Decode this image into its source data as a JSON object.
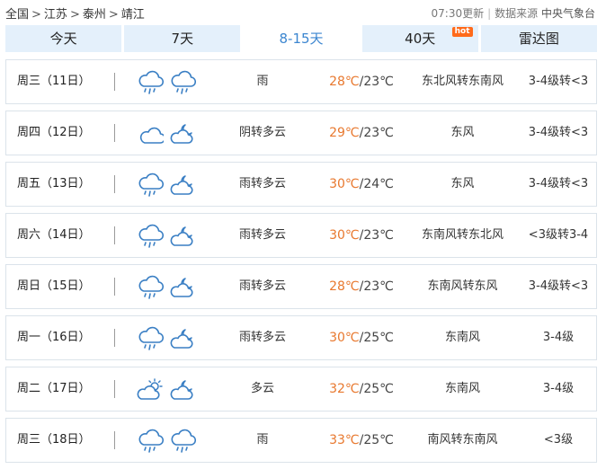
{
  "breadcrumb": [
    "全国",
    "江苏",
    "泰州",
    "靖江"
  ],
  "meta": {
    "updated": "07:30更新",
    "source_label": "数据来源",
    "source": "中央气象台"
  },
  "tabs": [
    {
      "label": "今天",
      "active": false,
      "hot": ""
    },
    {
      "label": "7天",
      "active": false,
      "hot": ""
    },
    {
      "label": "8-15天",
      "active": true,
      "hot": ""
    },
    {
      "label": "40天",
      "active": false,
      "hot": "hot"
    },
    {
      "label": "雷达图",
      "active": false,
      "hot": ""
    }
  ],
  "colors": {
    "high_temp": "#e8782e",
    "tab_bg": "#e4f0fb",
    "tab_active": "#3c86d0",
    "icon": "#3a7fc4"
  },
  "days": [
    {
      "day": "周三（11日）",
      "icons": [
        "rain-icon",
        "rain-icon"
      ],
      "desc": "雨",
      "high": "28℃",
      "low": "/23℃",
      "wind_dir": "东北风转东南风",
      "wind_level": "3-4级转<3"
    },
    {
      "day": "周四（12日）",
      "icons": [
        "cloudy-icon",
        "partly-cloudy-night-icon"
      ],
      "desc": "阴转多云",
      "high": "29℃",
      "low": "/23℃",
      "wind_dir": "东风",
      "wind_level": "3-4级转<3"
    },
    {
      "day": "周五（13日）",
      "icons": [
        "rain-icon",
        "partly-cloudy-night-icon"
      ],
      "desc": "雨转多云",
      "high": "30℃",
      "low": "/24℃",
      "wind_dir": "东风",
      "wind_level": "3-4级转<3"
    },
    {
      "day": "周六（14日）",
      "icons": [
        "rain-icon",
        "partly-cloudy-night-icon"
      ],
      "desc": "雨转多云",
      "high": "30℃",
      "low": "/23℃",
      "wind_dir": "东南风转东北风",
      "wind_level": "<3级转3-4"
    },
    {
      "day": "周日（15日）",
      "icons": [
        "rain-icon",
        "partly-cloudy-night-icon"
      ],
      "desc": "雨转多云",
      "high": "28℃",
      "low": "/23℃",
      "wind_dir": "东南风转东风",
      "wind_level": "3-4级转<3"
    },
    {
      "day": "周一（16日）",
      "icons": [
        "rain-icon",
        "partly-cloudy-night-icon"
      ],
      "desc": "雨转多云",
      "high": "30℃",
      "low": "/25℃",
      "wind_dir": "东南风",
      "wind_level": "3-4级"
    },
    {
      "day": "周二（17日）",
      "icons": [
        "partly-cloudy-day-icon",
        "partly-cloudy-night-icon"
      ],
      "desc": "多云",
      "high": "32℃",
      "low": "/25℃",
      "wind_dir": "东南风",
      "wind_level": "3-4级"
    },
    {
      "day": "周三（18日）",
      "icons": [
        "rain-icon",
        "rain-icon"
      ],
      "desc": "雨",
      "high": "33℃",
      "low": "/25℃",
      "wind_dir": "南风转东南风",
      "wind_level": "<3级"
    }
  ]
}
